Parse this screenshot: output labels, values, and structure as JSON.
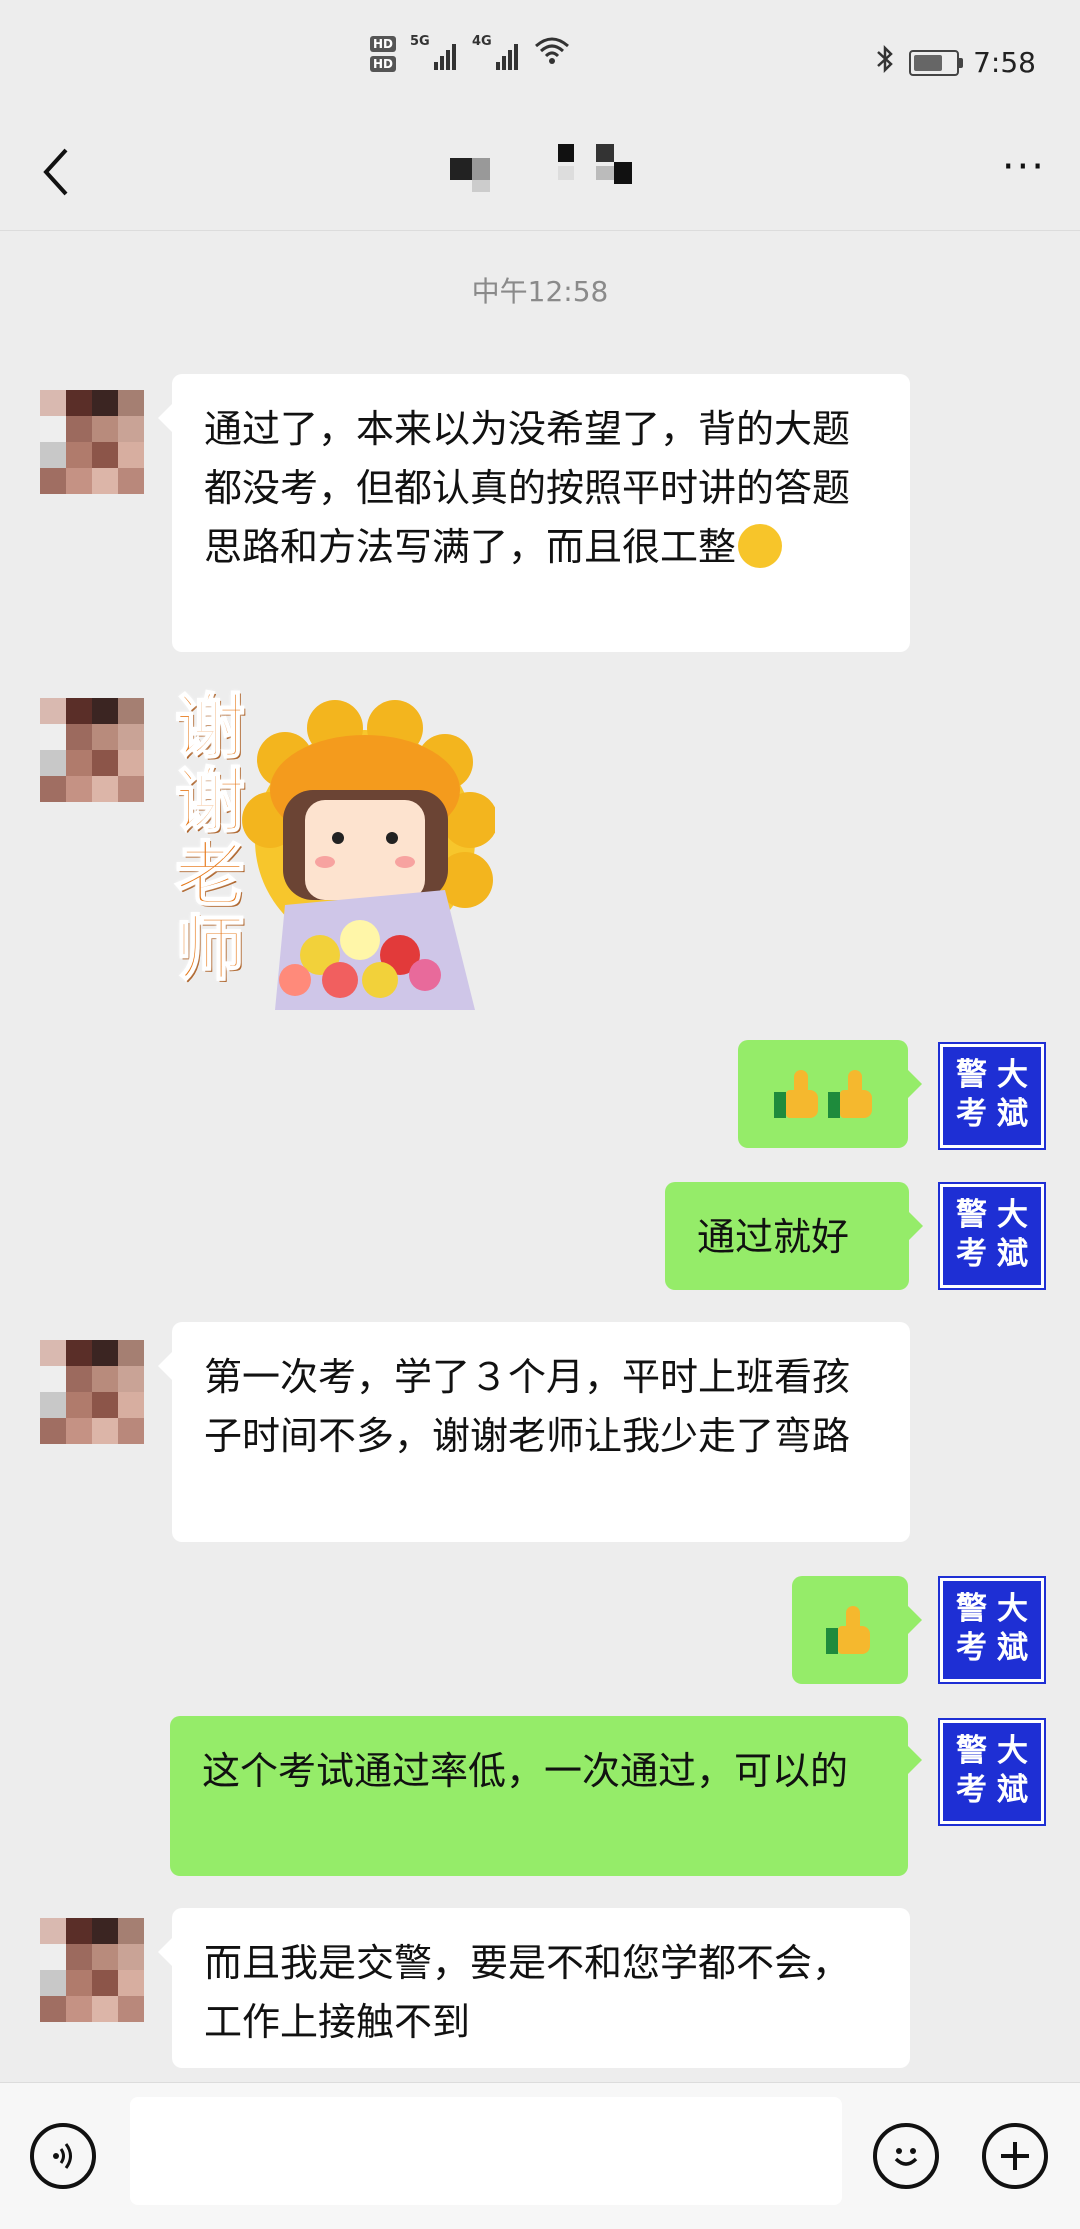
{
  "status": {
    "hd1": "HD",
    "hd2": "HD",
    "net1": "5G",
    "net2": "4G",
    "time": "7:58"
  },
  "chat": {
    "timestamp": "中午12:58",
    "messages": [
      {
        "side": "in",
        "text": "通过了，本来以为没希望了，背的大题都没考，但都认真的按照平时讲的答题思路和方法写满了，而且很工整"
      },
      {
        "side": "in",
        "type": "sticker",
        "text": "谢谢老师"
      },
      {
        "side": "out",
        "type": "emoji",
        "icon": "thumbs-up-icon",
        "count": 2
      },
      {
        "side": "out",
        "text": "通过就好"
      },
      {
        "side": "in",
        "text": "第一次考，学了３个月，平时上班看孩子时间不多，谢谢老师让我少走了弯路"
      },
      {
        "side": "out",
        "type": "emoji",
        "icon": "thumbs-up-icon",
        "count": 1
      },
      {
        "side": "out",
        "text": "这个考试通过率低，一次通过，可以的"
      },
      {
        "side": "in",
        "text": "而且我是交警，要是不和您学都不会，工作上接触不到"
      }
    ]
  },
  "self_avatar": {
    "c1": "警",
    "c2": "大",
    "c3": "考",
    "c4": "斌",
    "color": "#1e2fd4"
  },
  "colors": {
    "out_bubble": "#95ec69",
    "in_bubble": "#ffffff",
    "background": "#ededed"
  },
  "icons": {
    "back": "back-chevron-icon",
    "more": "more-dots-icon",
    "voice": "voice-icon",
    "emoji": "emoji-icon",
    "plus": "plus-icon"
  }
}
